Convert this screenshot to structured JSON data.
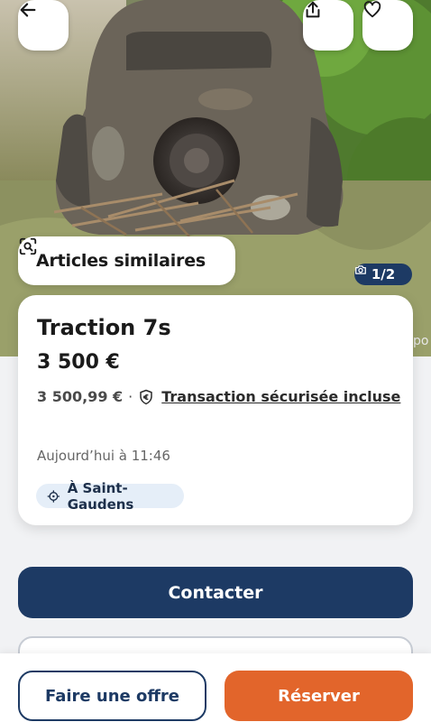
{
  "hero": {
    "similar_label": "Articles similaires",
    "photo_counter": "1/2",
    "edge_text": "po"
  },
  "icons": {
    "back": "arrow-left-icon",
    "share": "share-icon",
    "favorite": "heart-icon",
    "similar": "visual-search-icon",
    "camera": "camera-icon",
    "secure": "euro-shield-icon",
    "location": "location-target-icon"
  },
  "listing": {
    "title": "Traction 7s",
    "price": "3 500 €",
    "price_total": "3 500,99 €",
    "separator": "·",
    "secure_label": "Transaction sécurisée incluse",
    "date": "Aujourd’hui à 11:46",
    "location": "À Saint-Gaudens"
  },
  "actions": {
    "contact_label": "Contacter",
    "offer_label": "Faire une offre",
    "reserve_label": "Réserver"
  },
  "colors": {
    "primary": "#1d3a64",
    "accent": "#e2652b",
    "chip_bg": "#e5eef8"
  }
}
